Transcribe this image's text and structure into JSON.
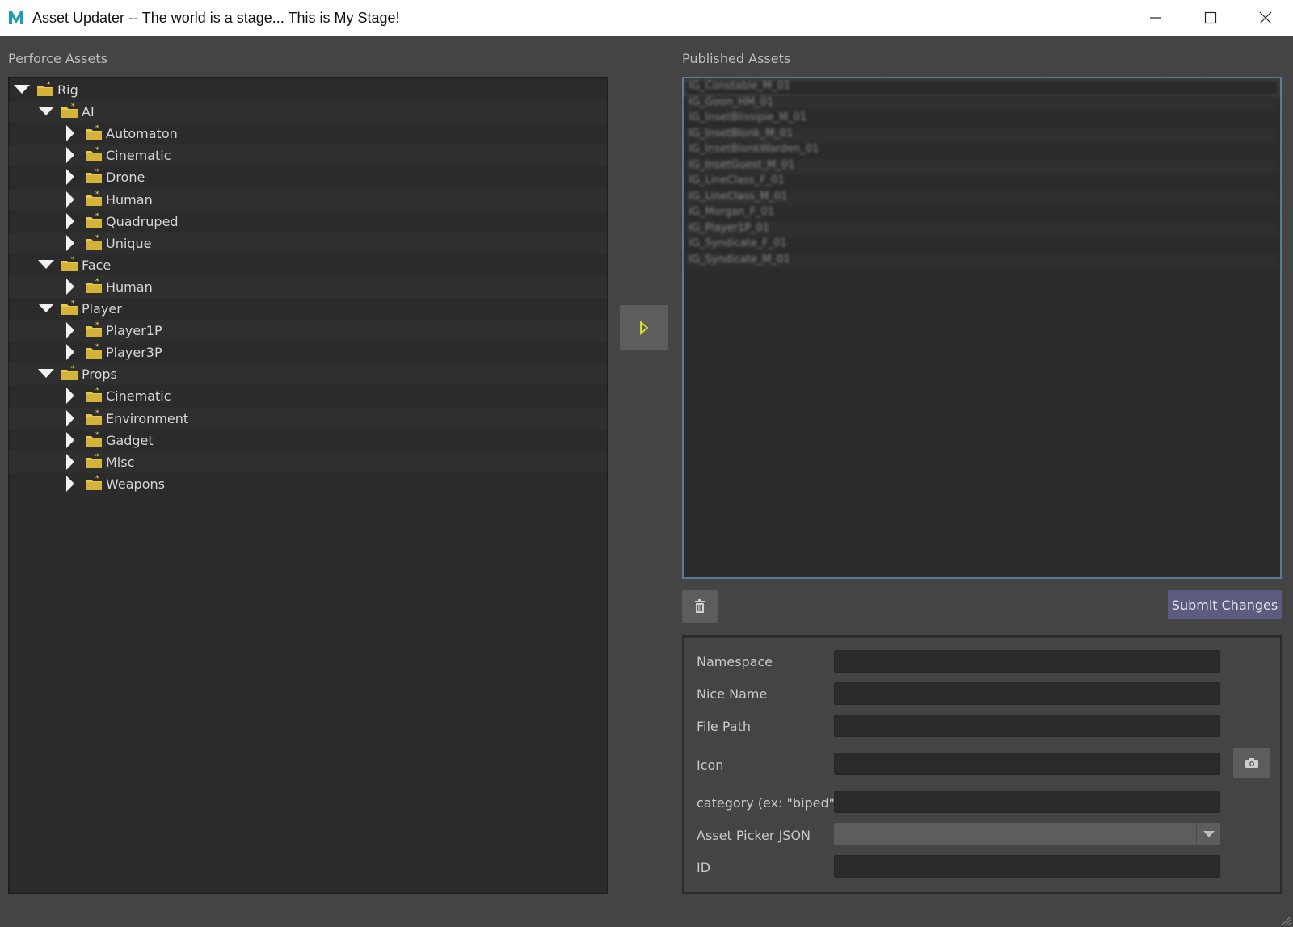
{
  "window": {
    "title": "Asset Updater -- The world is a stage... This is My Stage!"
  },
  "perforce": {
    "label": "Perforce Assets",
    "tree": [
      {
        "label": "Rig",
        "expanded": true
      },
      {
        "label": "AI",
        "expanded": true
      },
      {
        "label": "Automaton",
        "expanded": false
      },
      {
        "label": "Cinematic",
        "expanded": false
      },
      {
        "label": "Drone",
        "expanded": false
      },
      {
        "label": "Human",
        "expanded": false
      },
      {
        "label": "Quadruped",
        "expanded": false
      },
      {
        "label": "Unique",
        "expanded": false
      },
      {
        "label": "Face",
        "expanded": true
      },
      {
        "label": "Human",
        "expanded": false
      },
      {
        "label": "Player",
        "expanded": true
      },
      {
        "label": "Player1P",
        "expanded": false
      },
      {
        "label": "Player3P",
        "expanded": false
      },
      {
        "label": "Props",
        "expanded": true
      },
      {
        "label": "Cinematic",
        "expanded": false
      },
      {
        "label": "Environment",
        "expanded": false
      },
      {
        "label": "Gadget",
        "expanded": false
      },
      {
        "label": "Misc",
        "expanded": false
      },
      {
        "label": "Weapons",
        "expanded": false
      }
    ]
  },
  "published": {
    "label": "Published Assets",
    "items": [
      "IG_Constable_M_01",
      "IG_Goon_HM_01",
      "IG_InsetBlissipie_M_01",
      "IG_InsetBlonk_M_01",
      "IG_InsetBlonkWarden_01",
      "IG_InsetGuest_M_01",
      "IG_LineClass_F_01",
      "IG_LineClass_M_01",
      "IG_Morgan_F_01",
      "IG_Player1P_01",
      "IG_Syndicate_F_01",
      "IG_Syndicate_M_01"
    ]
  },
  "actions": {
    "submit_label": "Submit Changes"
  },
  "form": {
    "namespace_label": "Namespace",
    "namespace_value": "",
    "nice_name_label": "Nice Name",
    "nice_name_value": "",
    "file_path_label": "File Path",
    "file_path_value": "",
    "icon_label": "Icon",
    "icon_value": "",
    "category_label": "category (ex: \"biped\")",
    "category_value": "",
    "picker_label": "Asset Picker JSON",
    "picker_value": "",
    "id_label": "ID",
    "id_value": ""
  },
  "colors": {
    "background": "#444444",
    "panel": "#2b2b2b",
    "accent_button": "#5c5c80",
    "folder": "#e8c84a",
    "list_border": "#5a7a9a"
  }
}
